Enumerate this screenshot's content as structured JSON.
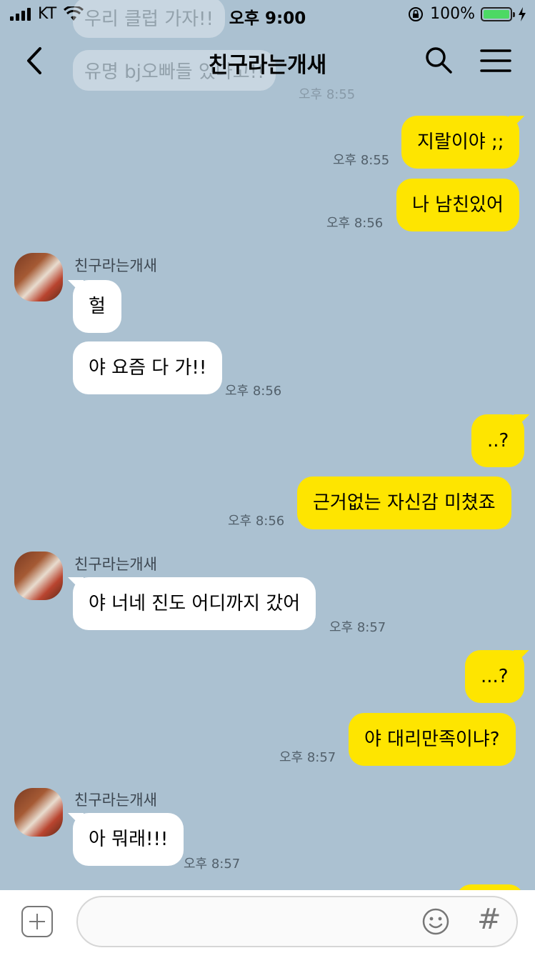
{
  "status_bar": {
    "carrier": "KT",
    "time": "오후 9:00",
    "battery_percent": "100%",
    "battery_level": 1.0
  },
  "header": {
    "title": "친구라는개새",
    "icons": [
      "back-chevron-icon",
      "search-icon",
      "menu-icon"
    ]
  },
  "scrolled_under": {
    "msg1": "우리 클럽 가자!!",
    "msg2": "유명 bj오빠들 있다고!!",
    "time": "오후 8:55"
  },
  "messages": {
    "m1": {
      "text": "지랄이야 ;;",
      "time": "오후 8:55"
    },
    "m2": {
      "text": "나 남친있어",
      "time": "오후 8:56"
    },
    "g1": {
      "sender": "친구라는개새",
      "b1": "헐",
      "b2": "야 요즘 다 가!!",
      "time": "오후 8:56"
    },
    "m3": {
      "text": "..?"
    },
    "m4": {
      "text": "근거없는 자신감 미쳤죠",
      "time": "오후 8:56"
    },
    "g2": {
      "sender": "친구라는개새",
      "b1": "야 너네 진도 어디까지 갔어",
      "time": "오후 8:57"
    },
    "m5": {
      "text": "...?"
    },
    "m6": {
      "text": "야 대리만족이냐?",
      "time": "오후 8:57"
    },
    "g3": {
      "sender": "친구라는개새",
      "b1": "아 뭐래!!!",
      "time": "오후 8:57"
    }
  },
  "input_bar": {
    "icons": [
      "plus-icon",
      "emoji-icon",
      "hashtag-icon"
    ],
    "hash_glyph": "#"
  },
  "colors": {
    "background": "#abc1d1",
    "my_bubble": "#fee500",
    "their_bubble": "#ffffff"
  }
}
